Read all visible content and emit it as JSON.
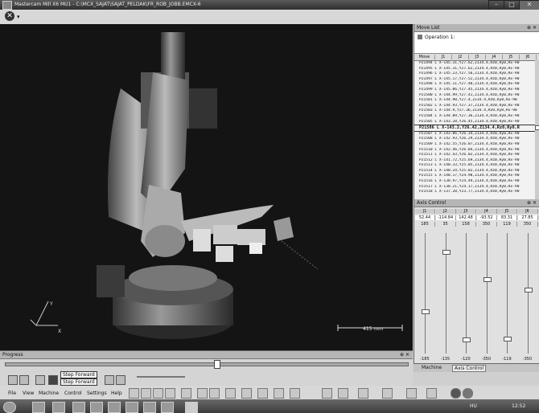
{
  "window": {
    "title": "Mastercam Mill X6 MU1 - C:\\MCX_SAJAT\\SAJAT_PELDAK\\FR_ROB_JOBB.EMCX-6"
  },
  "viewport": {
    "scale_label": "415 mm",
    "axis_labels": [
      "Y",
      "X"
    ]
  },
  "movelist": {
    "title": "Move List",
    "operation": "Operation 1:",
    "columns": [
      "Move",
      "J1",
      "J2",
      "J3",
      "J4",
      "J5",
      "J6"
    ],
    "rows": [
      "P21494 L X-145.31,Y27.62,Z134.4,Rz0,Ry0,Rx-90",
      "P21495 L X-145.31,Y27.62,Z134.4,Rz0,Ry0,Rx-90",
      "P21496 L X-145.23,Y27.56,Z134.4,Rz0,Ry0,Rx-90",
      "P21497 L X-145.17,Y27.52,Z134.4,Rz0,Ry0,Rx-90",
      "P21498 L X-145.11,Y27.48,Z134.4,Rz0,Ry0,Rx-90",
      "P21499 L X-145.06,Y27.45,Z134.4,Rz0,Ry0,Rx-90",
      "P21500 L X-144.99,Y27.41,Z134.4,Rz0,Ry0,Rx-90",
      "P21501 L X-144.90,Y27.4,Z134.4,Rz0,Ry0,Rx-90",
      "P21502 L X-144.93,Y27.37,Z134.4,Rz0,Ry0,Rx-90",
      "P21503 L X-144.9,Y27.36,Z134.4,Rz0,Ry0,Rx-90",
      "P21504 L X-144.89,Y27.36,Z134.4,Rz0,Ry0,Rx-90",
      "P21505 L X-143.28,Y26.45,Z134.4,Rz0,Ry0,Rx-90",
      "P21506 L X-143.2,Y26.42,Z134.4,Rz0,Ry0,R",
      "P21507 L X-143.06,Y26.34,Z134.4,Rz0,Ry0,Rx-90",
      "P21508 L X-142.93,Y26.29,Z134.4,Rz0,Ry0,Rx-90",
      "P21509 L X-142.55,Y26.07,Z134.4,Rz0,Ry0,Rx-90",
      "P21510 L X-142.46,Y26.04,Z134.4,Rz0,Ry0,Rx-90",
      "P21511 L X-142.43,Y26.02,Z134.4,Rz0,Ry0,Rx-90",
      "P21512 L X-141.72,Y25.69,Z134.4,Rz0,Ry0,Rx-90",
      "P21513 L X-140.33,Y25.05,Z134.4,Rz0,Ry0,Rx-90",
      "P21514 L X-140.24,Y25.02,Z134.4,Rz0,Ry0,Rx-90",
      "P21515 L X-140.17,Y24.98,Z134.4,Rz0,Ry0,Rx-90",
      "P21516 L X-138.97,Y24.49,Z134.4,Rz0,Ry0,Rx-90",
      "P21517 L X-138.21,Y24.17,Z134.4,Rz0,Ry0,Rx-90",
      "P21518 L X-137.28,Y23.77,Z134.4,Rz0,Ry0,Rx-90"
    ],
    "selected_index": 12
  },
  "axis": {
    "title": "Axis Control",
    "joints": [
      "J1",
      "J2",
      "J3",
      "J4",
      "J5",
      "J6"
    ],
    "values": [
      "52.44",
      "-114.84",
      "142.48",
      "-93.52",
      "83.31",
      "27.85"
    ],
    "max": [
      "185",
      "35",
      "158",
      "350",
      "119",
      "350"
    ],
    "min": [
      "-185",
      "-135",
      "-120",
      "-350",
      "-119",
      "-350"
    ],
    "slider_pos": [
      0.64,
      0.14,
      0.88,
      0.37,
      0.87,
      0.46
    ]
  },
  "tabs": {
    "machine": "Machine",
    "axis_control": "Axis Control"
  },
  "progress": {
    "title": "Progress",
    "level": 0.52,
    "tooltip1": "Step Forward",
    "tooltip2": "Step Forward"
  },
  "menu": {
    "file": "File",
    "view": "View",
    "machine": "Machine",
    "control": "Control",
    "settings": "Settings",
    "help": "Help"
  },
  "taskbar": {
    "lang": "HU",
    "time": "12:52"
  }
}
